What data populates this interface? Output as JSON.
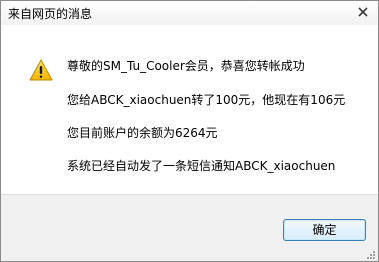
{
  "window": {
    "title": "来自网页的消息"
  },
  "icons": {
    "close": "close-icon",
    "warning": "warning-icon",
    "resize": "resize-grip-icon"
  },
  "message": {
    "line1": "尊敬的SM_Tu_Cooler会员，恭喜您转帐成功",
    "line2": "您给ABCK_xiaochuen转了100元，他现在有106元",
    "line3": "您目前账户的余额为6264元",
    "line4": "系统已经自动发了一条短信通知ABCK_xiaochuen"
  },
  "buttons": {
    "ok": "确定"
  },
  "colors": {
    "warning_fill": "#f5c400",
    "button_border": "#3c7fb1"
  }
}
